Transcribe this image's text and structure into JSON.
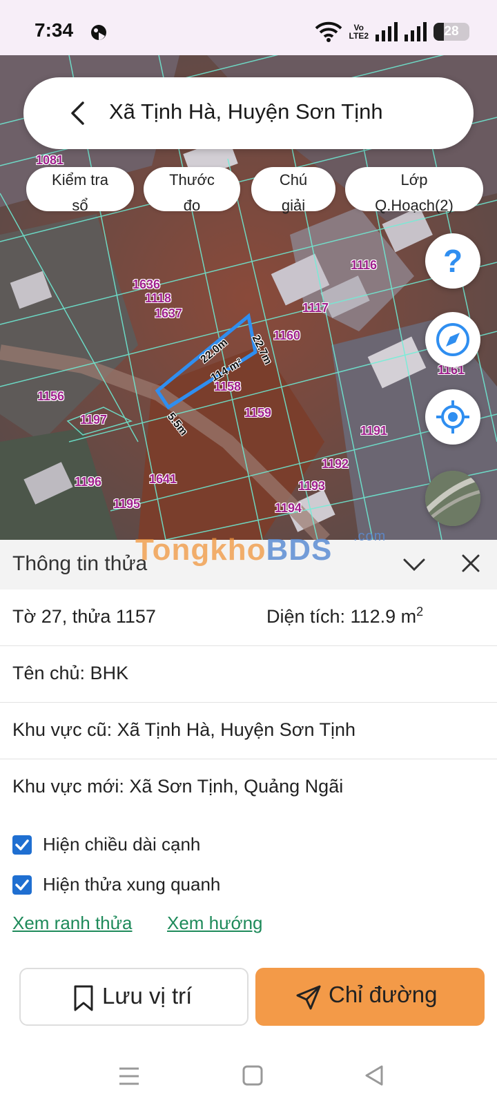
{
  "status_bar": {
    "time": "7:34",
    "network_label_top": "Vo",
    "network_label_bottom": "LTE2",
    "battery_level": "28",
    "icons": [
      "game-icon",
      "wifi-icon",
      "volte-icon",
      "signal-icon",
      "signal-icon",
      "battery-icon"
    ]
  },
  "search": {
    "title": "Xã Tịnh Hà, Huyện Sơn Tịnh",
    "back_icon": "chevron-left-icon"
  },
  "chips": [
    {
      "line1": "Kiểm tra",
      "line2": "sổ"
    },
    {
      "line1": "Thước",
      "line2": "đo"
    },
    {
      "line1": "Chú",
      "line2": "giải"
    },
    {
      "line1": "Lớp",
      "line2": "Q.Hoạch(2)"
    }
  ],
  "map": {
    "plot_labels": [
      "1081",
      "1116",
      "1636",
      "1118",
      "1637",
      "1117",
      "1160",
      "1161",
      "1156",
      "1197",
      "1158",
      "1159",
      "1191",
      "1192",
      "1196",
      "1641",
      "1193",
      "1195",
      "1194"
    ],
    "selected_parcel": {
      "edge_long": "22.0m",
      "edge_right": "22.7m",
      "edge_short": "5.5m",
      "area": "114 m²"
    },
    "highlight_color": "#2f8ef0",
    "fab_icons": [
      "help-icon",
      "compass-icon",
      "my-location-icon",
      "satellite-layer-icon"
    ]
  },
  "watermark": {
    "part1": "Tongkho",
    "part2": "BDS",
    "suffix": ".com"
  },
  "panel": {
    "header": "Thông tin thửa",
    "sheet_parcel": "Tờ 27, thửa 1157",
    "area_label": "Diện tích: 112.9 m",
    "area_sup": "2",
    "owner": "Tên chủ: BHK",
    "old_area": "Khu vực cũ: Xã Tịnh Hà, Huyện Sơn Tịnh",
    "new_area": "Khu vực mới: Xã Sơn Tịnh, Quảng Ngãi",
    "checkbox_edges": "Hiện chiều dài cạnh",
    "checkbox_neighbors": "Hiện thửa xung quanh",
    "link_boundary": "Xem ranh thửa",
    "link_direction": "Xem hướng",
    "save_label": "Lưu vị trí",
    "directions_label": "Chỉ đường"
  },
  "colors": {
    "accent_orange": "#f39a48",
    "checkbox_blue": "#1f6fd1",
    "link_green": "#1e8a5a",
    "plot_label_purple": "#a0208e"
  }
}
